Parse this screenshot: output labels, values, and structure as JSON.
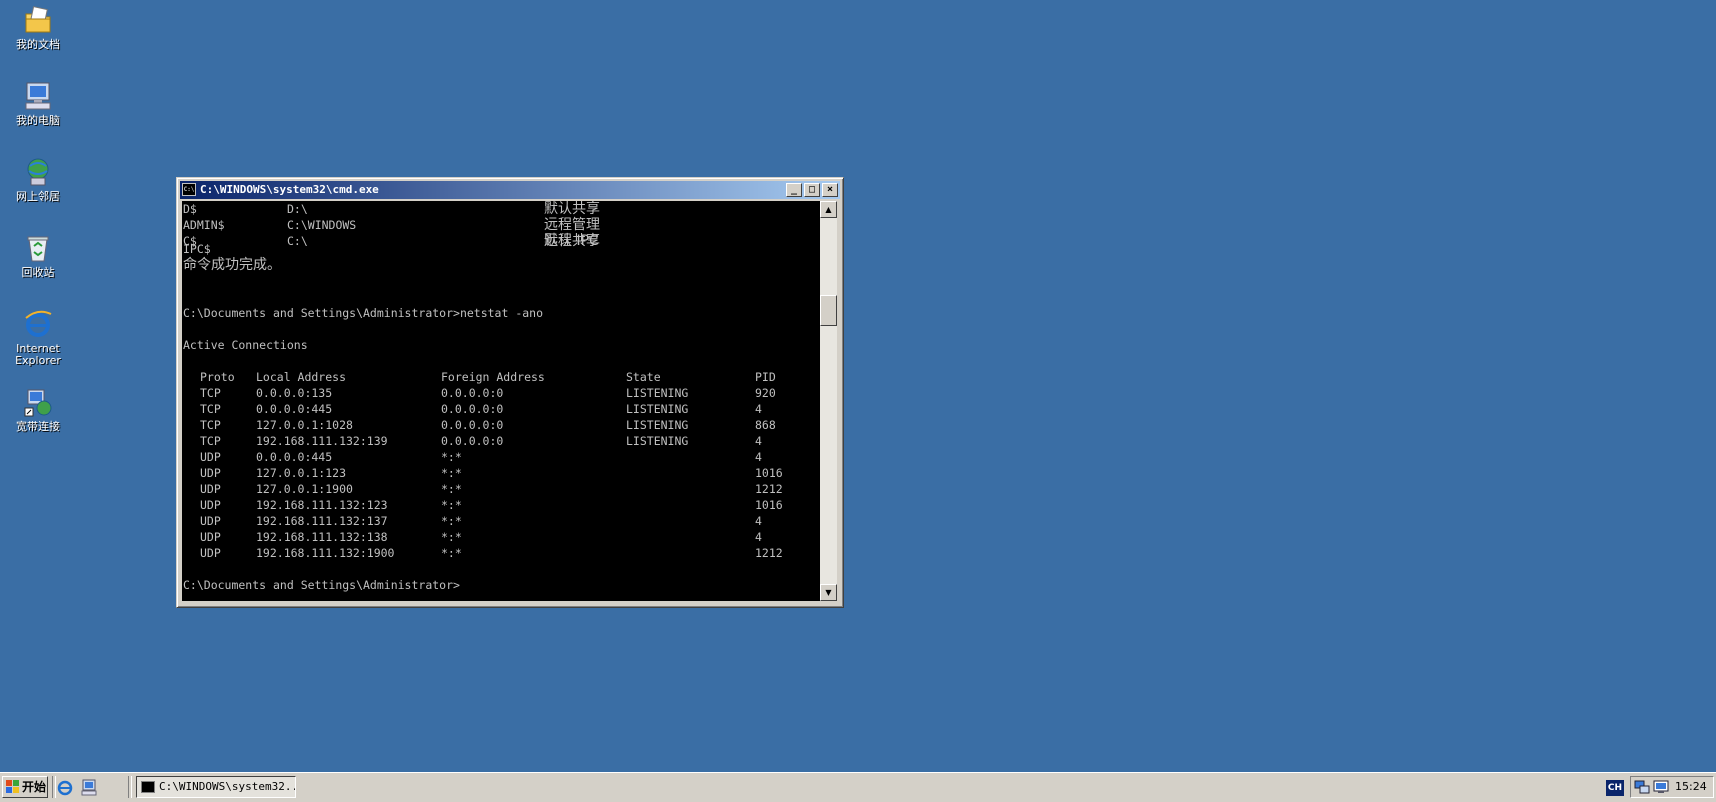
{
  "desktop": {
    "icons": [
      {
        "label": "我的文档",
        "icon": "my-documents-icon"
      },
      {
        "label": "我的电脑",
        "icon": "my-computer-icon"
      },
      {
        "label": "网上邻居",
        "icon": "network-places-icon"
      },
      {
        "label": "回收站",
        "icon": "recycle-bin-icon"
      },
      {
        "label": "Internet Explorer",
        "icon": "internet-explorer-icon"
      },
      {
        "label": "宽带连接",
        "icon": "broadband-connection-icon"
      }
    ]
  },
  "window": {
    "title": "C:\\WINDOWS\\system32\\cmd.exe",
    "buttons": {
      "minimize": "_",
      "maximize": "□",
      "close": "×"
    },
    "console": {
      "share_rows": [
        {
          "name": "D$",
          "path": "D:\\",
          "remark": "默认共享"
        },
        {
          "name": "ADMIN$",
          "path": "C:\\WINDOWS",
          "remark": "远程管理"
        },
        {
          "name": "C$",
          "path": "C:\\",
          "remark": "默认共享"
        },
        {
          "name": "IPC$",
          "path": "",
          "remark": "远程 IPC"
        }
      ],
      "success_msg": "命令成功完成。",
      "prompt_cmd": "C:\\Documents and Settings\\Administrator>netstat -ano",
      "active_heading": "Active Connections",
      "table_headers": [
        "Proto",
        "Local Address",
        "Foreign Address",
        "State",
        "PID"
      ],
      "rows": [
        [
          "TCP",
          "0.0.0.0:135",
          "0.0.0.0:0",
          "LISTENING",
          "920"
        ],
        [
          "TCP",
          "0.0.0.0:445",
          "0.0.0.0:0",
          "LISTENING",
          "4"
        ],
        [
          "TCP",
          "127.0.0.1:1028",
          "0.0.0.0:0",
          "LISTENING",
          "868"
        ],
        [
          "TCP",
          "192.168.111.132:139",
          "0.0.0.0:0",
          "LISTENING",
          "4"
        ],
        [
          "UDP",
          "0.0.0.0:445",
          "*:*",
          "",
          "4"
        ],
        [
          "UDP",
          "127.0.0.1:123",
          "*:*",
          "",
          "1016"
        ],
        [
          "UDP",
          "127.0.0.1:1900",
          "*:*",
          "",
          "1212"
        ],
        [
          "UDP",
          "192.168.111.132:123",
          "*:*",
          "",
          "1016"
        ],
        [
          "UDP",
          "192.168.111.132:137",
          "*:*",
          "",
          "4"
        ],
        [
          "UDP",
          "192.168.111.132:138",
          "*:*",
          "",
          "4"
        ],
        [
          "UDP",
          "192.168.111.132:1900",
          "*:*",
          "",
          "1212"
        ]
      ],
      "final_prompt": "C:\\Documents and Settings\\Administrator>"
    }
  },
  "taskbar": {
    "start_label": "开始",
    "task_button_label": "C:\\WINDOWS\\system32...",
    "language": "CH",
    "clock": "15:24"
  },
  "colors": {
    "desktop": "#3a6ea5",
    "titlebar_start": "#0a246a",
    "titlebar_end": "#a6caf0",
    "console_bg": "#000000",
    "console_fg": "#c0c0c0"
  }
}
